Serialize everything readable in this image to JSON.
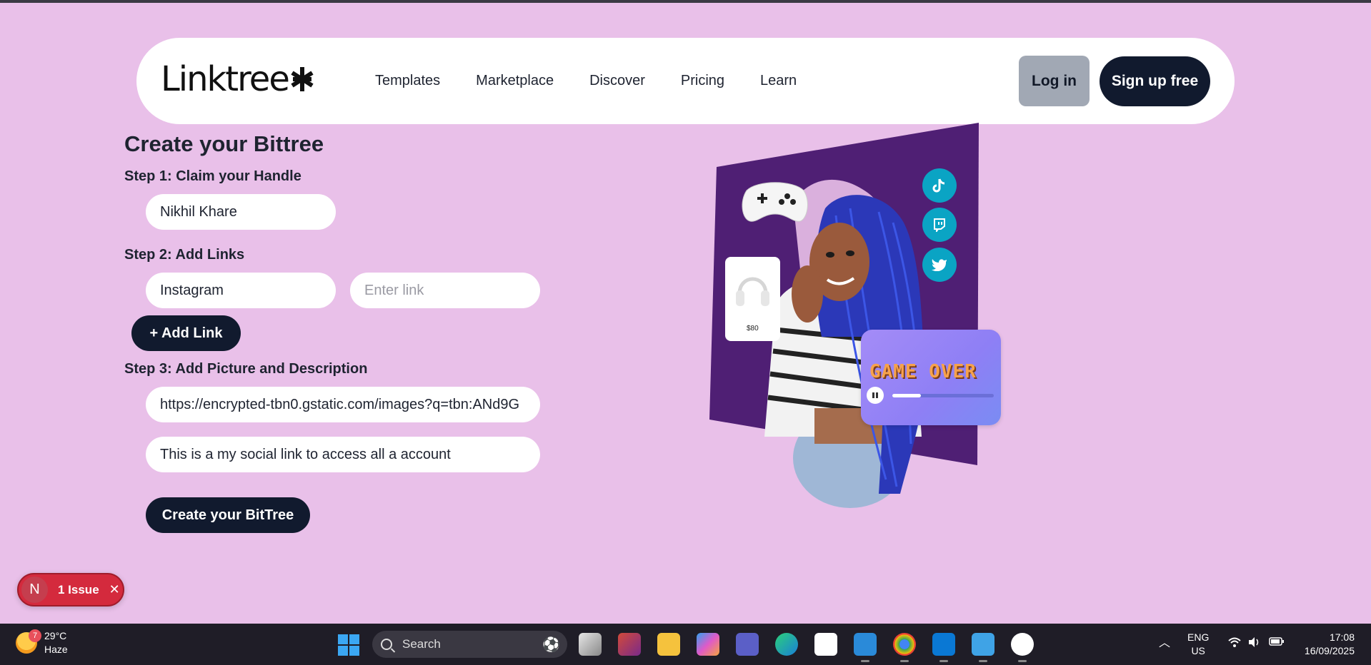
{
  "navbar": {
    "logo_text": "Linktree",
    "links": [
      "Templates",
      "Marketplace",
      "Discover",
      "Pricing",
      "Learn"
    ],
    "login_label": "Log in",
    "signup_label": "Sign up free"
  },
  "form": {
    "title": "Create your Bittree",
    "step1_label": "Step 1: Claim your Handle",
    "handle_value": "Nikhil Khare",
    "step2_label": "Step 2: Add Links",
    "link_name_value": "Instagram",
    "link_url_placeholder": "Enter link",
    "add_link_label": "+ Add Link",
    "step3_label": "Step 3: Add Picture and Description",
    "picture_url_value": "https://encrypted-tbn0.gstatic.com/images?q=tbn:ANd9G",
    "description_value": "This is a my social link to access all a account",
    "submit_label": "Create your BitTree"
  },
  "hero": {
    "game_over_text": "GAME OVER",
    "price_tag": "$80",
    "social_icons": [
      "tiktok-icon",
      "twitch-icon",
      "twitter-icon"
    ]
  },
  "issue_badge": {
    "initial": "N",
    "label": "1 Issue"
  },
  "taskbar": {
    "weather_temp": "29°C",
    "weather_desc": "Haze",
    "weather_badge": "7",
    "search_label": "Search",
    "lang_top": "ENG",
    "lang_bottom": "US",
    "time": "17:08",
    "date": "16/09/2025"
  },
  "colors": {
    "background": "#e9c0e9",
    "dark_button": "#111a2e",
    "login_button": "#a1a8b4",
    "hero_panel": "#4f1f74",
    "social_icon": "#0aa4c4",
    "issue_badge": "#d42a3d"
  }
}
